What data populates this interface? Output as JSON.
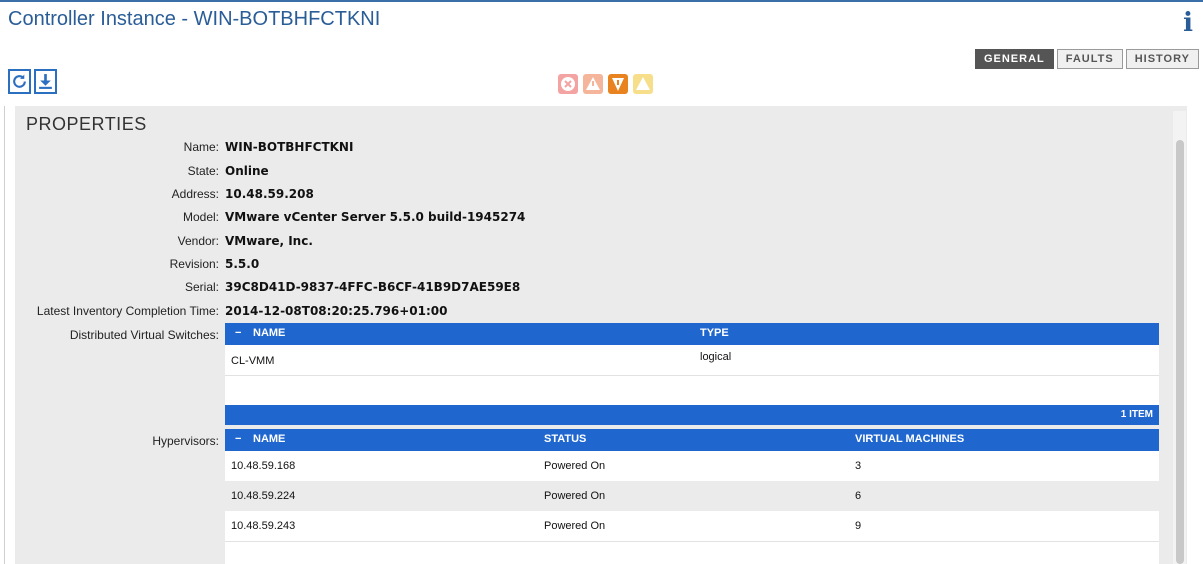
{
  "header": {
    "title": "Controller Instance - WIN-BOTBHFCTKNI",
    "info_icon": "info-icon"
  },
  "tabs": [
    {
      "label": "GENERAL",
      "active": true
    },
    {
      "label": "FAULTS",
      "active": false
    },
    {
      "label": "HISTORY",
      "active": false
    }
  ],
  "toolbar": {
    "icons": [
      "refresh-icon",
      "download-icon"
    ]
  },
  "fault_summary": {
    "icons": [
      "critical-fault-icon",
      "major-fault-icon",
      "minor-fault-icon",
      "warning-fault-icon"
    ],
    "colors": [
      "#f4a3a3",
      "#f4b59a",
      "#e8831f",
      "#f7de8a"
    ]
  },
  "properties": {
    "heading": "PROPERTIES",
    "fields": [
      {
        "label": "Name:",
        "value": "WIN-BOTBHFCTKNI"
      },
      {
        "label": "State:",
        "value": "Online"
      },
      {
        "label": "Address:",
        "value": "10.48.59.208"
      },
      {
        "label": "Model:",
        "value": "VMware vCenter Server 5.5.0 build-1945274"
      },
      {
        "label": "Vendor:",
        "value": "VMware, Inc."
      },
      {
        "label": "Revision:",
        "value": "5.5.0"
      },
      {
        "label": "Serial:",
        "value": "39C8D41D-9837-4FFC-B6CF-41B9D7AE59E8"
      },
      {
        "label": "Latest Inventory Completion Time:",
        "value": "2014-12-08T08:20:25.796+01:00"
      }
    ],
    "dvs_label": "Distributed Virtual Switches:",
    "hypervisors_label": "Hypervisors:"
  },
  "dvs_table": {
    "collapse": "−",
    "columns": [
      "NAME",
      "TYPE"
    ],
    "rows": [
      {
        "name": "CL-VMM",
        "type": "logical"
      }
    ],
    "footer": "1 ITEM"
  },
  "hypervisors_table": {
    "collapse": "−",
    "columns": [
      "NAME",
      "STATUS",
      "VIRTUAL MACHINES"
    ],
    "rows": [
      {
        "name": "10.48.59.168",
        "status": "Powered On",
        "vms": "3"
      },
      {
        "name": "10.48.59.224",
        "status": "Powered On",
        "vms": "6"
      },
      {
        "name": "10.48.59.243",
        "status": "Powered On",
        "vms": "9"
      }
    ]
  },
  "colors": {
    "title": "#2a5d97",
    "table_header": "#1f67cf",
    "panel_bg": "#ebebeb"
  }
}
